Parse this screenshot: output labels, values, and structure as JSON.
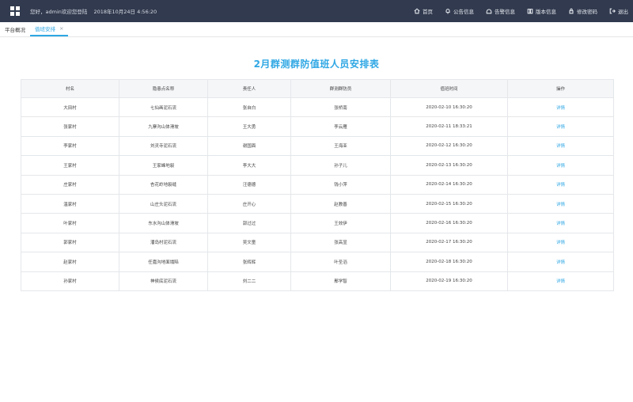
{
  "header": {
    "greeting": "您好，admin欢迎您登陆",
    "datetime": "2018年10月24日 4:56:20",
    "nav": [
      {
        "label": "首页",
        "icon": "home-icon"
      },
      {
        "label": "公告信息",
        "icon": "bell-icon"
      },
      {
        "label": "告警信息",
        "icon": "alert-icon"
      },
      {
        "label": "版本信息",
        "icon": "book-icon"
      },
      {
        "label": "修改密码",
        "icon": "lock-icon"
      },
      {
        "label": "退出",
        "icon": "logout-icon"
      }
    ]
  },
  "tabs": [
    {
      "label": "平台概况",
      "active": false
    },
    {
      "label": "值班安排",
      "active": true,
      "close": "×"
    }
  ],
  "page": {
    "title": "2月群测群防值班人员安排表"
  },
  "table": {
    "headers": [
      "村名",
      "隐患点名称",
      "责任人",
      "群测群防员",
      "值班时间",
      "操作"
    ],
    "rows": [
      [
        "大田村",
        "七仙画泥石流",
        "张自白",
        "张桥南",
        "2020-02-10 16:30:20",
        "详情"
      ],
      [
        "张家村",
        "九寨沟山体滑坡",
        "王大勇",
        "李云雁",
        "2020-02-11 18:33:21",
        "详情"
      ],
      [
        "李家村",
        "刘灵寺泥石流",
        "谢国面",
        "王海亚",
        "2020-02-12 16:30:20",
        "详情"
      ],
      [
        "王家村",
        "王家峰地裂",
        "李大大",
        "孙子儿",
        "2020-02-13 16:30:20",
        "详情"
      ],
      [
        "庄家村",
        "杏花岭地裂缝",
        "汪德德",
        "钱小萍",
        "2020-02-14 16:30:20",
        "详情"
      ],
      [
        "温家村",
        "山庄头泥石流",
        "庄开心",
        "赵教善",
        "2020-02-15 16:30:20",
        "详情"
      ],
      [
        "叶家村",
        "东水沟山体滑坡",
        "郭过过",
        "王效伊",
        "2020-02-16 16:30:20",
        "详情"
      ],
      [
        "郭家村",
        "潘岛村泥石流",
        "吴文童",
        "张高显",
        "2020-02-17 16:30:20",
        "详情"
      ],
      [
        "赵家村",
        "任嘉沟地面塌陷",
        "张辉辉",
        "叶圣滔",
        "2020-02-18 16:30:20",
        "详情"
      ],
      [
        "孙家村",
        "神侯底泥石流",
        "刘二二",
        "鄢学智",
        "2020-02-19 16:30:20",
        "详情"
      ]
    ]
  }
}
